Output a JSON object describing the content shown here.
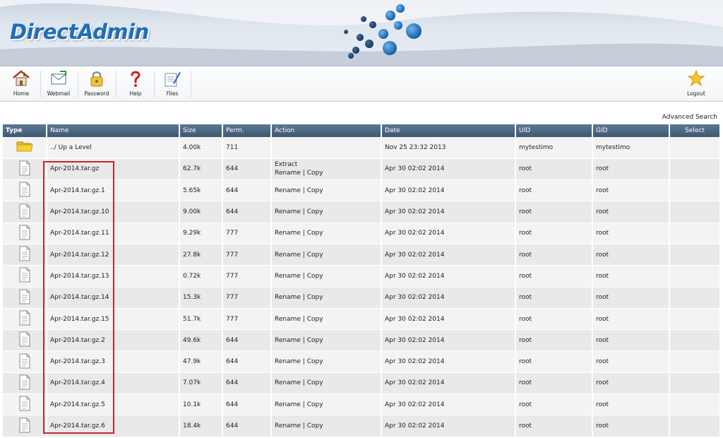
{
  "header": {
    "logo_text": "DirectAdmin"
  },
  "toolbar": {
    "items": [
      {
        "label": "Home",
        "icon": "house-icon"
      },
      {
        "label": "Webmail",
        "icon": "mail-icon"
      },
      {
        "label": "Password",
        "icon": "padlock-icon"
      },
      {
        "label": "Help",
        "icon": "question-icon"
      },
      {
        "label": "Files",
        "icon": "files-icon"
      }
    ],
    "logout_label": "Logout"
  },
  "advanced_search": "Advanced Search",
  "table": {
    "columns": [
      "Type",
      "Name",
      "Size",
      "Perm.",
      "Action",
      "Date",
      "UID",
      "GID",
      "Select"
    ],
    "up_level": {
      "name": "../ Up a Level",
      "size": "4.00k",
      "perm": "711",
      "date": "Nov 25 23:32 2013",
      "uid": "mytestimo",
      "gid": "mytestimo"
    },
    "action_extract": "Extract",
    "action_rename": "Rename",
    "action_sep": "|",
    "action_copy": "Copy",
    "rows": [
      {
        "name": "Apr-2014.tar.gz",
        "size": "62.7k",
        "perm": "644",
        "date": "Apr 30 02:02 2014",
        "uid": "root",
        "gid": "root",
        "extract": true
      },
      {
        "name": "Apr-2014.tar.gz.1",
        "size": "5.65k",
        "perm": "644",
        "date": "Apr 30 02:02 2014",
        "uid": "root",
        "gid": "root",
        "extract": false
      },
      {
        "name": "Apr-2014.tar.gz.10",
        "size": "9.00k",
        "perm": "644",
        "date": "Apr 30 02:02 2014",
        "uid": "root",
        "gid": "root",
        "extract": false
      },
      {
        "name": "Apr-2014.tar.gz.11",
        "size": "9.29k",
        "perm": "777",
        "date": "Apr 30 02:02 2014",
        "uid": "root",
        "gid": "root",
        "extract": false
      },
      {
        "name": "Apr-2014.tar.gz.12",
        "size": "27.8k",
        "perm": "777",
        "date": "Apr 30 02:02 2014",
        "uid": "root",
        "gid": "root",
        "extract": false
      },
      {
        "name": "Apr-2014.tar.gz.13",
        "size": "0.72k",
        "perm": "777",
        "date": "Apr 30 02:02 2014",
        "uid": "root",
        "gid": "root",
        "extract": false
      },
      {
        "name": "Apr-2014.tar.gz.14",
        "size": "15.3k",
        "perm": "777",
        "date": "Apr 30 02:02 2014",
        "uid": "root",
        "gid": "root",
        "extract": false
      },
      {
        "name": "Apr-2014.tar.gz.15",
        "size": "51.7k",
        "perm": "777",
        "date": "Apr 30 02:02 2014",
        "uid": "root",
        "gid": "root",
        "extract": false
      },
      {
        "name": "Apr-2014.tar.gz.2",
        "size": "49.6k",
        "perm": "644",
        "date": "Apr 30 02:02 2014",
        "uid": "root",
        "gid": "root",
        "extract": false
      },
      {
        "name": "Apr-2014.tar.gz.3",
        "size": "47.9k",
        "perm": "644",
        "date": "Apr 30 02:02 2014",
        "uid": "root",
        "gid": "root",
        "extract": false
      },
      {
        "name": "Apr-2014.tar.gz.4",
        "size": "7.07k",
        "perm": "644",
        "date": "Apr 30 02:02 2014",
        "uid": "root",
        "gid": "root",
        "extract": false
      },
      {
        "name": "Apr-2014.tar.gz.5",
        "size": "10.1k",
        "perm": "644",
        "date": "Apr 30 02:02 2014",
        "uid": "root",
        "gid": "root",
        "extract": false
      },
      {
        "name": "Apr-2014.tar.gz.6",
        "size": "18.4k",
        "perm": "644",
        "date": "Apr 30 02:02 2014",
        "uid": "root",
        "gid": "root",
        "extract": false
      }
    ]
  },
  "colors": {
    "header_bar": "#4b6683",
    "logo_blue": "#1e6fb8",
    "highlight_box": "#c8262c"
  }
}
